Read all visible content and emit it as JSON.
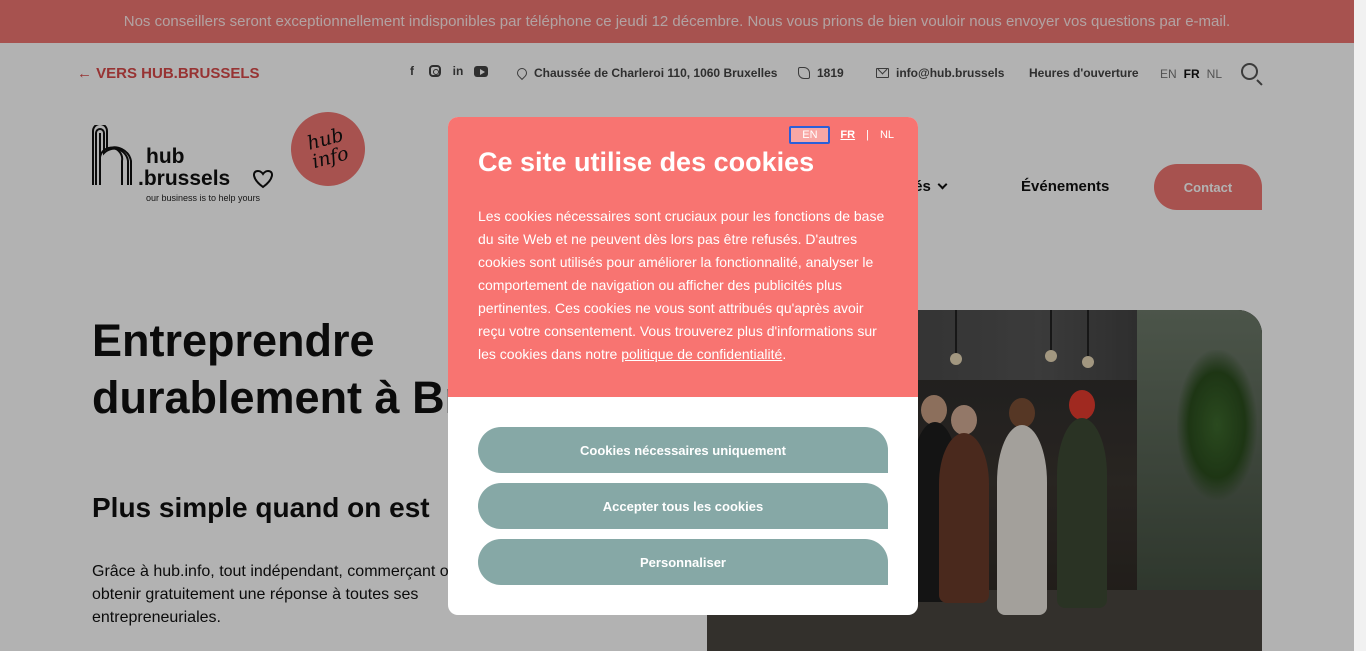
{
  "banner": {
    "text": "Nos conseillers seront exceptionnellement indisponibles par téléphone ce jeudi 12 décembre. Nous vous prions de bien vouloir nous envoyer vos questions par e-mail."
  },
  "topbar": {
    "back_link": "← VERS HUB.BRUSSELS",
    "socials": [
      "facebook-icon",
      "instagram-icon",
      "linkedin-icon",
      "youtube-icon"
    ],
    "address": "Chaussée de Charleroi 110, 1060 Bruxelles",
    "phone": "1819",
    "email": "info@hub.brussels",
    "hours": "Heures d'ouverture",
    "languages": [
      "EN",
      "FR",
      "NL"
    ],
    "active_language": "FR"
  },
  "logo": {
    "line1": "hub",
    "line2": ".brussels",
    "tagline": "our business is to help yours",
    "badge_line1": "hub",
    "badge_line2": "info"
  },
  "nav": {
    "item_partial": "ités",
    "events": "Événements",
    "contact": "Contact"
  },
  "hero": {
    "title": "Entreprendre durablement à Bruxelles",
    "subtitle": "Plus simple quand on est",
    "text": "Grâce à hub.info, tout indépendant, commerçant ou peut obtenir gratuitement une réponse à toutes ses entrepreneuriales."
  },
  "cookie_modal": {
    "languages": [
      "EN",
      "FR",
      "NL"
    ],
    "focused_language": "EN",
    "active_language": "FR",
    "title": "Ce site utilise des cookies",
    "body": "Les cookies nécessaires sont cruciaux pour les fonctions de base du site Web et ne peuvent dès lors pas être refusés. D'autres cookies sont utilisés pour améliorer la fonctionnalité, analyser le comportement de navigation ou afficher des publicités plus pertinentes. Ces cookies ne vous sont attribués qu'après avoir reçu votre consentement. Vous trouverez plus d'informations sur les cookies dans notre ",
    "policy_link": "politique de confidentialité",
    "body_end": ".",
    "buttons": {
      "necessary": "Cookies nécessaires uniquement",
      "accept_all": "Accepter tous les cookies",
      "customize": "Personnaliser"
    }
  },
  "colors": {
    "brand_coral": "#f07672",
    "modal_coral": "#f87471",
    "button_teal": "#86a8a6"
  }
}
